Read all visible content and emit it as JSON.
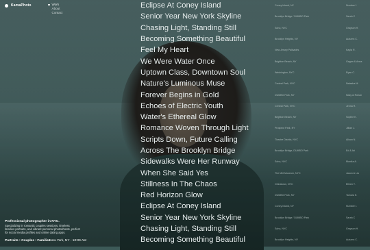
{
  "brand": {
    "name": "KamaPhoto"
  },
  "nav": {
    "items": [
      "Work",
      "About",
      "Contact"
    ]
  },
  "projects": [
    {
      "title": "Eclipse At Coney Island",
      "location": "Coney Island, NY",
      "number": "Number 1"
    },
    {
      "title": "Senior Year New York Skyline",
      "location": "Brooklyn Bridge / DUMBO Park",
      "number": "Sarah C"
    },
    {
      "title": "Chasing Light, Standing Still",
      "location": "Soho, NYC",
      "number": "Grayson H."
    },
    {
      "title": "Becoming Something Beautiful",
      "location": "Brooklyn Heights, NY",
      "number": "Autumn C."
    },
    {
      "title": "Feel My Heart",
      "location": "New Jersey Palisades",
      "number": "Kayla R."
    },
    {
      "title": "We Were Water Once",
      "location": "Brighton Beach, NY",
      "number": "Gagan & Anna"
    },
    {
      "title": "Uptown Class, Downtown Soul",
      "location": "Washington, NYC",
      "number": "Ryan C."
    },
    {
      "title": "Nature's Luminous Muse",
      "location": "Central Park, NYC",
      "number": "Natasha M."
    },
    {
      "title": "Forever Begins in Gold",
      "location": "DUMBO Park, NY",
      "number": "Nasy & Rohan"
    },
    {
      "title": "Echoes of Electric Youth",
      "location": "Central Park, NYC",
      "number": "Jenna R."
    },
    {
      "title": "Water's Ethereal Glow",
      "location": "Brighton Beach, NY",
      "number": "Sophie K."
    },
    {
      "title": "Romance Woven Through Light",
      "location": "Prospect Park, NY",
      "number": "Jillian J."
    },
    {
      "title": "Scripts Down, Future Calling",
      "location": "Theatre District, NYC",
      "number": "Alison N."
    },
    {
      "title": "Across The Brooklyn Bridge",
      "location": "Brooklyn Bridge, DUMBO Park",
      "number": "Ed & Ari"
    },
    {
      "title": "Sidewalks Were Her Runway",
      "location": "Soho, NYC",
      "number": "Monika A."
    },
    {
      "title": "When She Said Yes",
      "location": "The Met Museum, NYC",
      "number": "Jason & Lia"
    },
    {
      "title": "Stillness In The Chaos",
      "location": "Chinatown, NYC",
      "number": "Eileen T."
    },
    {
      "title": "Red Horizon Glow",
      "location": "DUMBO Park, NY",
      "number": "Tamara E."
    },
    {
      "title": "Eclipse At Coney Island",
      "location": "Coney Island, NY",
      "number": "Number 1"
    },
    {
      "title": "Senior Year New York Skyline",
      "location": "Brooklyn Bridge / DUMBO Park",
      "number": "Sarah C"
    },
    {
      "title": "Chasing Light, Standing Still",
      "location": "Soho, NYC",
      "number": "Grayson H."
    },
    {
      "title": "Becoming Something Beautiful",
      "location": "Brooklyn Heights, NY",
      "number": "Autumn C."
    }
  ],
  "about": {
    "heading": "Professional photographer in NYC.",
    "text": "Specializing in romantic couples sessions, timeless families portraits, and vibrant personal photoshoots, perfect for social media profiles and online dating apps."
  },
  "footer": {
    "categories": "Portraits • Couples • Families",
    "location_time": "New York, NY - 10:09 AM"
  }
}
